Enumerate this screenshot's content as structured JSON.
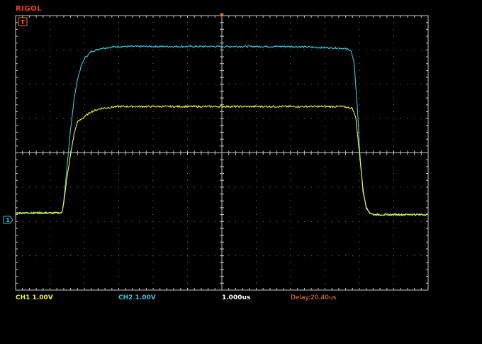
{
  "brand": "RIGOL",
  "trigger_marker": "T",
  "ground_marker": "1",
  "status": {
    "ch1": "CH1 1.00V",
    "ch2": "CH2 1.00V",
    "timebase": "1.000us",
    "delay": "Delay:20.40us"
  },
  "colors": {
    "ch1": "#f2f23c",
    "ch2": "#3cc8dc",
    "timebase": "#ffffff",
    "delay": "#ff8040",
    "brand": "#ff3c1e",
    "grid": "#c8c8c8",
    "trigger_marker": "#ff7020"
  },
  "chart_data": {
    "type": "line",
    "x_unit": "div",
    "y_unit": "div",
    "xlim": [
      0,
      12
    ],
    "ylim": [
      -4,
      4
    ],
    "series": [
      {
        "name": "CH1",
        "x": [
          0,
          1.35,
          1.4,
          1.5,
          1.6,
          1.7,
          1.8,
          2.0,
          2.2,
          2.5,
          3.0,
          4.0,
          6.0,
          8.0,
          9.5,
          9.8,
          9.9,
          10.0,
          10.1,
          10.2,
          10.3,
          10.4,
          12
        ],
        "y": [
          -1.75,
          -1.75,
          -1.45,
          -0.7,
          -0.05,
          0.55,
          0.9,
          1.05,
          1.2,
          1.3,
          1.35,
          1.35,
          1.35,
          1.35,
          1.35,
          1.3,
          1.0,
          0.0,
          -1.0,
          -1.6,
          -1.75,
          -1.8,
          -1.8
        ]
      },
      {
        "name": "CH2",
        "x": [
          0,
          1.35,
          1.4,
          1.5,
          1.6,
          1.7,
          1.8,
          1.9,
          2.0,
          2.2,
          2.5,
          3.0,
          5.0,
          8.0,
          9.5,
          9.75,
          9.85,
          9.95,
          10.0,
          10.1,
          10.2,
          10.3,
          10.4,
          12
        ],
        "y": [
          -1.75,
          -1.75,
          -1.4,
          -0.4,
          0.7,
          1.55,
          2.15,
          2.5,
          2.75,
          2.95,
          3.05,
          3.1,
          3.1,
          3.1,
          3.05,
          3.0,
          2.6,
          1.2,
          0.2,
          -1.1,
          -1.6,
          -1.75,
          -1.8,
          -1.8
        ]
      }
    ]
  }
}
